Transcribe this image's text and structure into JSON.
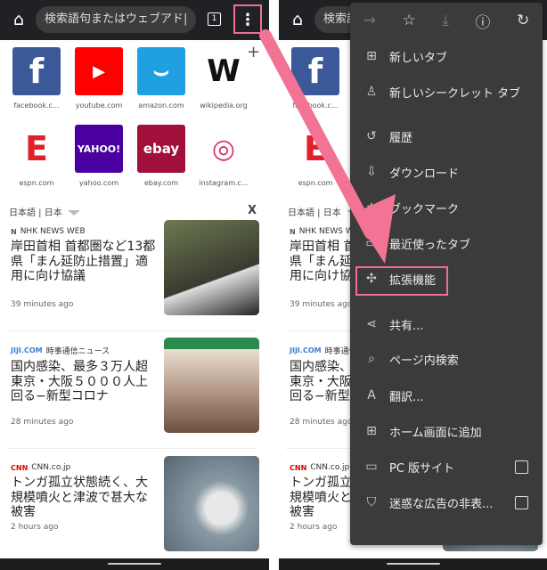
{
  "toolbar": {
    "home_icon": "home-icon",
    "omnibox_placeholder": "検索語句またはウェブアド|",
    "tab_count": "1",
    "more_icon": "⋮"
  },
  "tiles": [
    {
      "label": "facebook.c...",
      "glyph": "f",
      "color": "#3b5998"
    },
    {
      "label": "youtube.com",
      "glyph": "▶",
      "color": "#ff0000"
    },
    {
      "label": "amazon.com",
      "glyph": "⌣",
      "color": "#1fa0e0"
    },
    {
      "label": "wikipedia.org",
      "glyph": "W",
      "color": "#ffffff"
    },
    {
      "label": "espn.com",
      "glyph": "E",
      "color": "#ffffff"
    },
    {
      "label": "yahoo.com",
      "glyph": "YAHOO!",
      "color": "#4a00a0"
    },
    {
      "label": "ebay.com",
      "glyph": "ebay",
      "color": "#a0103a"
    },
    {
      "label": "instagram.c...",
      "glyph": "◎",
      "color": "#ffffff"
    }
  ],
  "feed": {
    "language": "日本語 | 日本",
    "close": "X",
    "articles": [
      {
        "source": "NHK NEWS WEB",
        "source_icon": "N",
        "headline": "岸田首相 首都圏など13都県「まん延防止措置」適用に向け協議",
        "time": "39 minutes ago"
      },
      {
        "source": "時事通信ニュース",
        "source_icon": "JIJI.COM",
        "headline": "国内感染、最多３万人超 東京・大阪５０００人上回る−新型コロナ",
        "time": "28 minutes ago"
      },
      {
        "source": "CNN.co.jp",
        "source_icon": "CNN",
        "headline": "トンガ孤立状態続く、大規模噴火と津波で甚大な被害",
        "time": "2 hours ago"
      }
    ]
  },
  "menu": {
    "top_icons": [
      "→",
      "☆",
      "⤓",
      "ⓘ",
      "↻"
    ],
    "items": [
      {
        "label": "新しいタブ",
        "icon": "⊞"
      },
      {
        "label": "新しいシークレット タブ",
        "icon": "♙"
      },
      {
        "label": "履歴",
        "icon": "↺"
      },
      {
        "label": "ダウンロード",
        "icon": "⇩"
      },
      {
        "label": "ブックマーク",
        "icon": "★"
      },
      {
        "label": "最近使ったタブ",
        "icon": "▭"
      },
      {
        "label": "拡張機能",
        "icon": "✣"
      },
      {
        "label": "共有...",
        "icon": "⋖"
      },
      {
        "label": "ページ内検索",
        "icon": "⌕"
      },
      {
        "label": "翻訳...",
        "icon": "A"
      },
      {
        "label": "ホーム画面に追加",
        "icon": "⊞"
      },
      {
        "label": "PC 版サイト",
        "icon": "▭",
        "checked": false
      },
      {
        "label": "迷惑な広告の非表...",
        "icon": "⛉",
        "checked": false
      }
    ]
  },
  "colors": {
    "highlight": "#ef6f8f",
    "menu_bg": "#3b3b3c"
  }
}
